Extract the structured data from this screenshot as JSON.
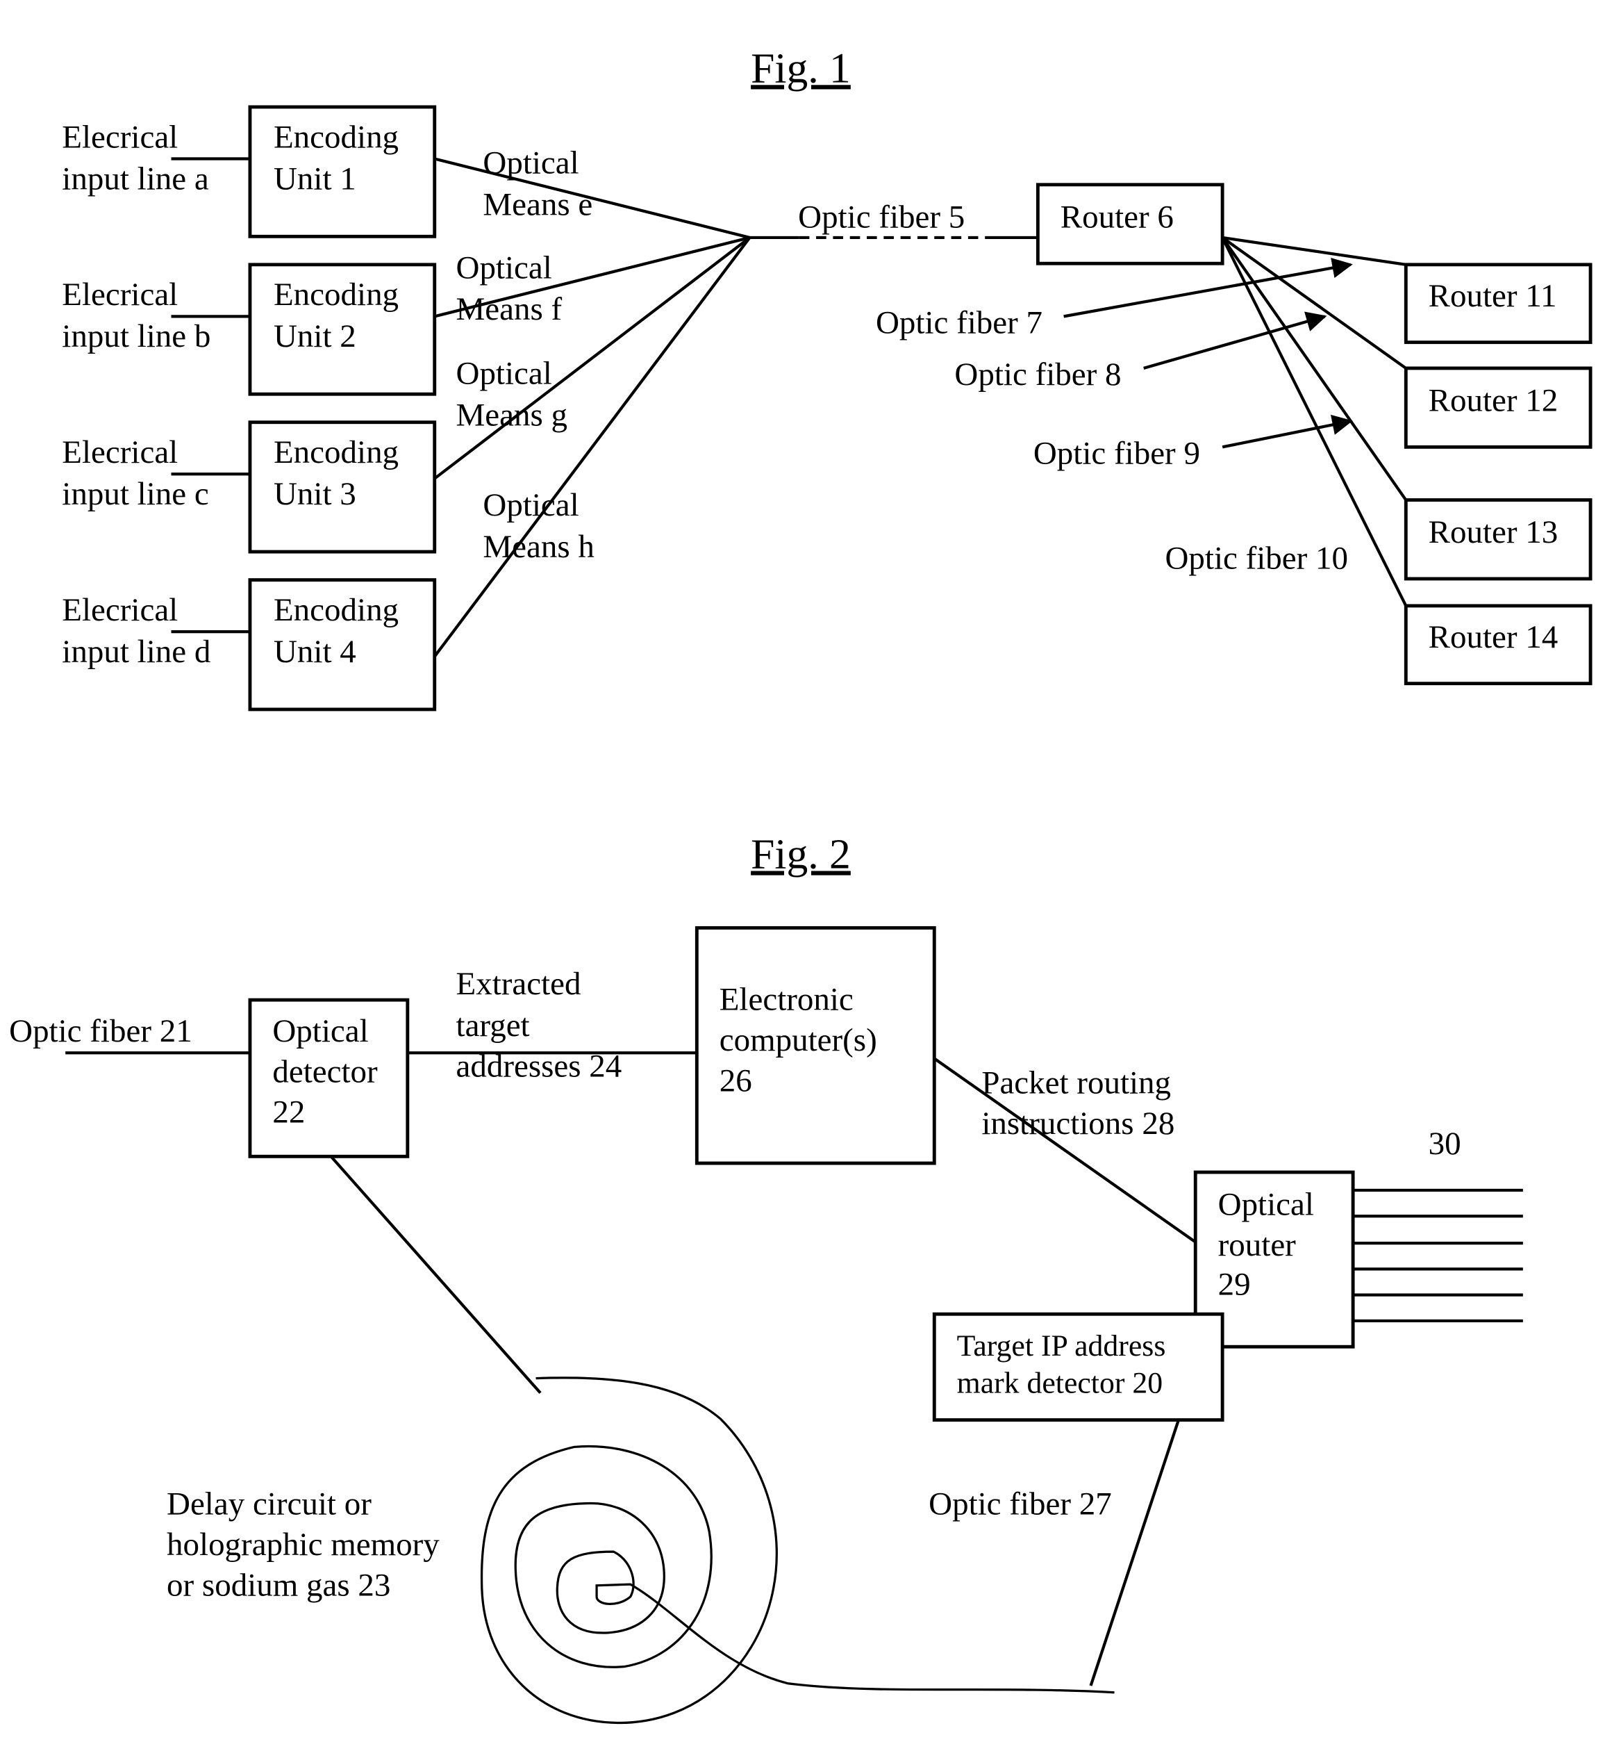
{
  "fig1": {
    "title": "Fig. 1",
    "inputs": [
      {
        "line1": "Elecrical",
        "line2": "input line a"
      },
      {
        "line1": "Elecrical",
        "line2": "input line b"
      },
      {
        "line1": "Elecrical",
        "line2": "input line c"
      },
      {
        "line1": "Elecrical",
        "line2": "input line d"
      }
    ],
    "encoders": [
      {
        "line1": "Encoding",
        "line2": "Unit 1"
      },
      {
        "line1": "Encoding",
        "line2": "Unit 2"
      },
      {
        "line1": "Encoding",
        "line2": "Unit 3"
      },
      {
        "line1": "Encoding",
        "line2": "Unit 4"
      }
    ],
    "optical_means": [
      {
        "line1": "Optical",
        "line2": "Means e"
      },
      {
        "line1": "Optical",
        "line2": "Means f"
      },
      {
        "line1": "Optical",
        "line2": "Means g"
      },
      {
        "line1": "Optical",
        "line2": "Means h"
      }
    ],
    "fiber5": "Optic fiber 5",
    "router6": "Router 6",
    "fibers": [
      "Optic fiber 7",
      "Optic fiber 8",
      "Optic fiber 9",
      "Optic fiber 10"
    ],
    "routers": [
      "Router 11",
      "Router 12",
      "Router 13",
      "Router 14"
    ]
  },
  "fig2": {
    "title": "Fig. 2",
    "fiber21": "Optic fiber 21",
    "detector": [
      "Optical",
      "detector",
      "22"
    ],
    "extracted": [
      "Extracted",
      "target",
      "addresses 24"
    ],
    "computer": [
      "Electronic",
      "computer(s)",
      "26"
    ],
    "packet": [
      "Packet routing",
      "instructions 28"
    ],
    "label30": "30",
    "router": [
      "Optical",
      "router",
      "29"
    ],
    "mark_detector": [
      "Target IP address",
      "mark detector 20"
    ],
    "fiber27": "Optic fiber 27",
    "delay": [
      "Delay circuit or",
      "holographic memory",
      "or sodium gas 23"
    ]
  }
}
